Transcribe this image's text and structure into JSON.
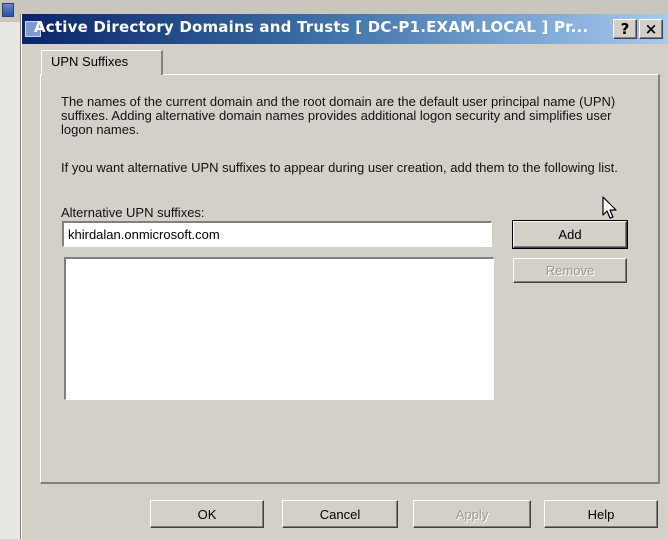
{
  "window": {
    "title": "Active Directory Domains and Trusts [ DC-P1.EXAM.LOCAL ] Pr...",
    "help_caption": "?",
    "close_caption": "×"
  },
  "tabs": [
    {
      "label": "UPN Suffixes",
      "selected": true
    }
  ],
  "upn": {
    "description": "The names of the current domain and the root domain are the default user principal name (UPN) suffixes. Adding alternative domain names provides additional logon security and simplifies user logon names.",
    "instruction": "If you want alternative UPN suffixes to appear during user creation, add them to the following list.",
    "field_label": "Alternative UPN suffixes:",
    "input_value": "khirdalan.onmicrosoft.com",
    "list_items": [],
    "add_label": "Add",
    "remove_label": "Remove",
    "remove_enabled": false
  },
  "footer": {
    "ok_label": "OK",
    "cancel_label": "Cancel",
    "apply_label": "Apply",
    "apply_enabled": false,
    "help_label": "Help"
  },
  "icons": {
    "title_icon": "window-icon",
    "cursor": "mouse-pointer-icon"
  },
  "colors": {
    "titlebar_start": "#0a246a",
    "titlebar_end": "#a6caf0",
    "face": "#d4d0c8"
  }
}
